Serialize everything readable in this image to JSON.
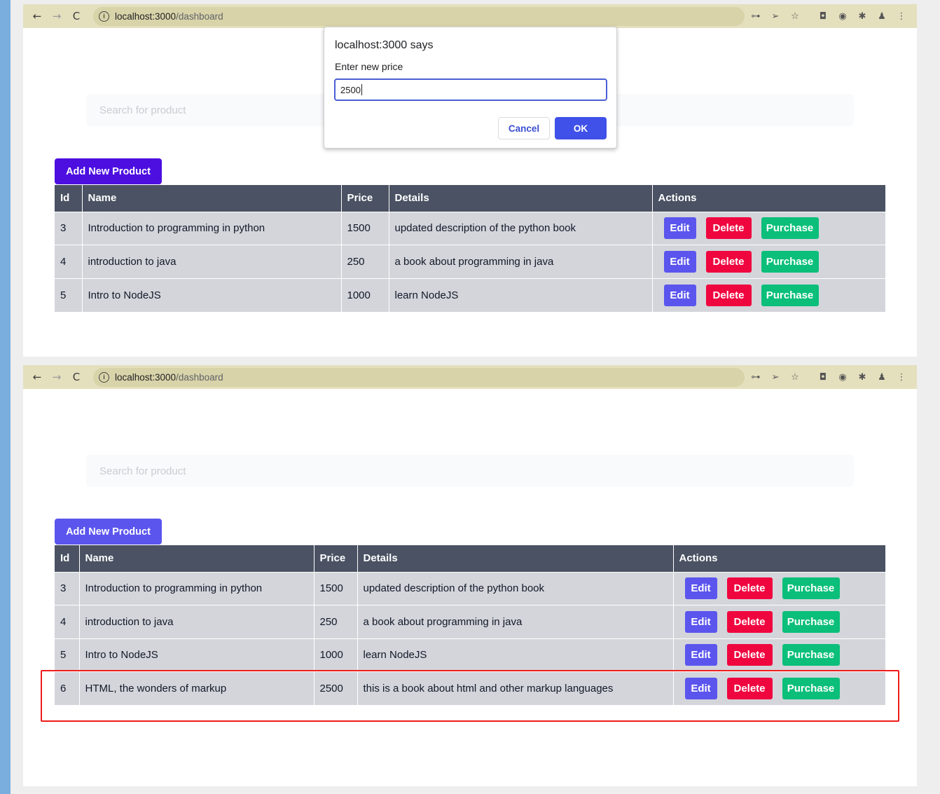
{
  "colors": {
    "left_stripe": "#7aaede",
    "browser_bar": "#e4dfbd",
    "table_header": "#4a5263",
    "table_row": "#d3d5db",
    "add_button_top": "#4c0fe0",
    "add_button_bottom": "#5b55ee",
    "edit": "#5b55ee",
    "delete": "#f0063f",
    "purchase": "#0bbf7a",
    "highlight": "#ee1c1c"
  },
  "browser": {
    "url_host": "localhost:3000",
    "url_path": "/dashboard",
    "icons": [
      "back-icon",
      "forward-icon",
      "reload-icon",
      "info-icon",
      "key-icon",
      "send-icon",
      "star-icon",
      "camera-icon",
      "extension-icon",
      "puzzle-icon",
      "profile-icon",
      "menu-icon"
    ],
    "glyphs": {
      "back": "←",
      "forward": "→",
      "reload": "C",
      "info": "i",
      "key": "⊶",
      "send": "➢",
      "star": "☆",
      "camera": "◘",
      "ext": "◉",
      "puzzle": "✱",
      "profile": "♟",
      "menu": "⋮"
    }
  },
  "page": {
    "search_placeholder": "Search for product",
    "add_button": "Add New Product",
    "columns": [
      "Id",
      "Name",
      "Price",
      "Details",
      "Actions"
    ],
    "actions": {
      "edit": "Edit",
      "delete": "Delete",
      "purchase": "Purchase"
    }
  },
  "dialog": {
    "title": "localhost:3000 says",
    "message": "Enter new price",
    "input_value": "2500",
    "cancel": "Cancel",
    "ok": "OK"
  },
  "before": {
    "rows": [
      {
        "id": "3",
        "name": "Introduction to programming in python",
        "price": "1500",
        "details": "updated description of the python book"
      },
      {
        "id": "4",
        "name": "introduction to java",
        "price": "250",
        "details": "a book about programming in java"
      },
      {
        "id": "5",
        "name": "Intro to NodeJS",
        "price": "1000",
        "details": "learn NodeJS"
      }
    ]
  },
  "after": {
    "rows": [
      {
        "id": "3",
        "name": "Introduction to programming in python",
        "price": "1500",
        "details": "updated description of the python book"
      },
      {
        "id": "4",
        "name": "introduction to java",
        "price": "250",
        "details": "a book about programming in java"
      },
      {
        "id": "5",
        "name": "Intro to NodeJS",
        "price": "1000",
        "details": "learn NodeJS"
      },
      {
        "id": "6",
        "name": "HTML, the wonders of markup",
        "price": "2500",
        "details": "this is a book about html and other markup languages"
      }
    ]
  }
}
